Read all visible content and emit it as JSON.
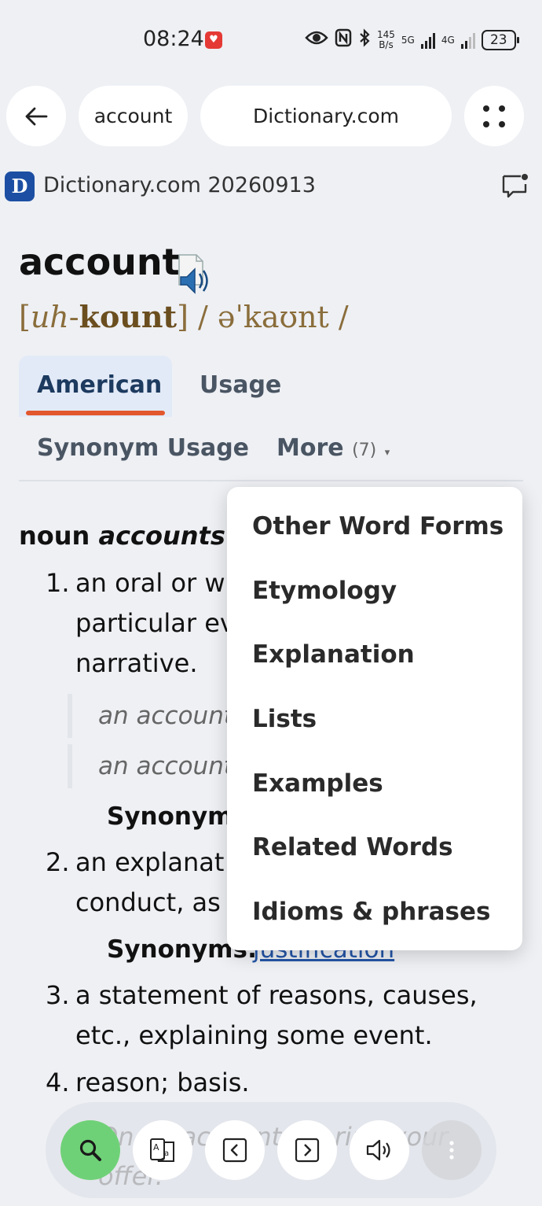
{
  "status_bar": {
    "time": "08:24",
    "net_speed": [
      "145",
      "B/s"
    ],
    "net_5g": "5G",
    "net_4g": "4G",
    "battery": "23"
  },
  "nav": {
    "query": "account",
    "site": "Dictionary.com"
  },
  "source": {
    "logo_letter": "D",
    "name": "Dictionary.com 20260913"
  },
  "entry": {
    "headword": "account",
    "pron_open": "[",
    "pron_italic": "uh",
    "pron_hyphen": "-",
    "pron_bold": "kount",
    "pron_close": "] / əˈkaʊnt /"
  },
  "tabs": {
    "american": "American",
    "usage": "Usage",
    "synonym_usage": "Synonym Usage",
    "more": "More",
    "more_count": "(7)",
    "more_caret": "▾"
  },
  "definitions": {
    "pos": "noun",
    "pos_form": "accounts",
    "items": [
      {
        "num": "1.",
        "lines": [
          "an oral or w",
          "particular ev",
          "narrative."
        ]
      },
      {
        "num": "2.",
        "lines": [
          "an explanat",
          "conduct, as"
        ]
      },
      {
        "num": "3.",
        "lines": [
          "a statement of reasons, causes,",
          "etc., explaining some event."
        ]
      },
      {
        "num": "4.",
        "lines": [
          "reason; basis."
        ]
      }
    ],
    "examples": [
      "an account",
      "an account"
    ],
    "synonyms_label_1": "Synonym",
    "synonyms_label_2": "Synonyms:",
    "synonym_link_2": "justification",
    "bg_example_lines": [
      "On no account s... ring your",
      "offer."
    ]
  },
  "dropdown": {
    "items": [
      "Other Word Forms",
      "Etymology",
      "Explanation",
      "Lists",
      "Examples",
      "Related Words",
      "Idioms & phrases"
    ]
  },
  "colors": {
    "accent": "#e2572e",
    "link": "#2455a6",
    "pron": "#8a6d3b",
    "search_button": "#6fd177"
  },
  "icons": {
    "back": "arrow-left",
    "menu": "four-dots",
    "feedback": "comment-bubble",
    "audio": "speaker",
    "search": "magnifier",
    "translate": "translate-book",
    "prev": "chevron-left-box",
    "next": "chevron-right-box",
    "speak": "speaker-waves",
    "more": "vertical-dots"
  }
}
